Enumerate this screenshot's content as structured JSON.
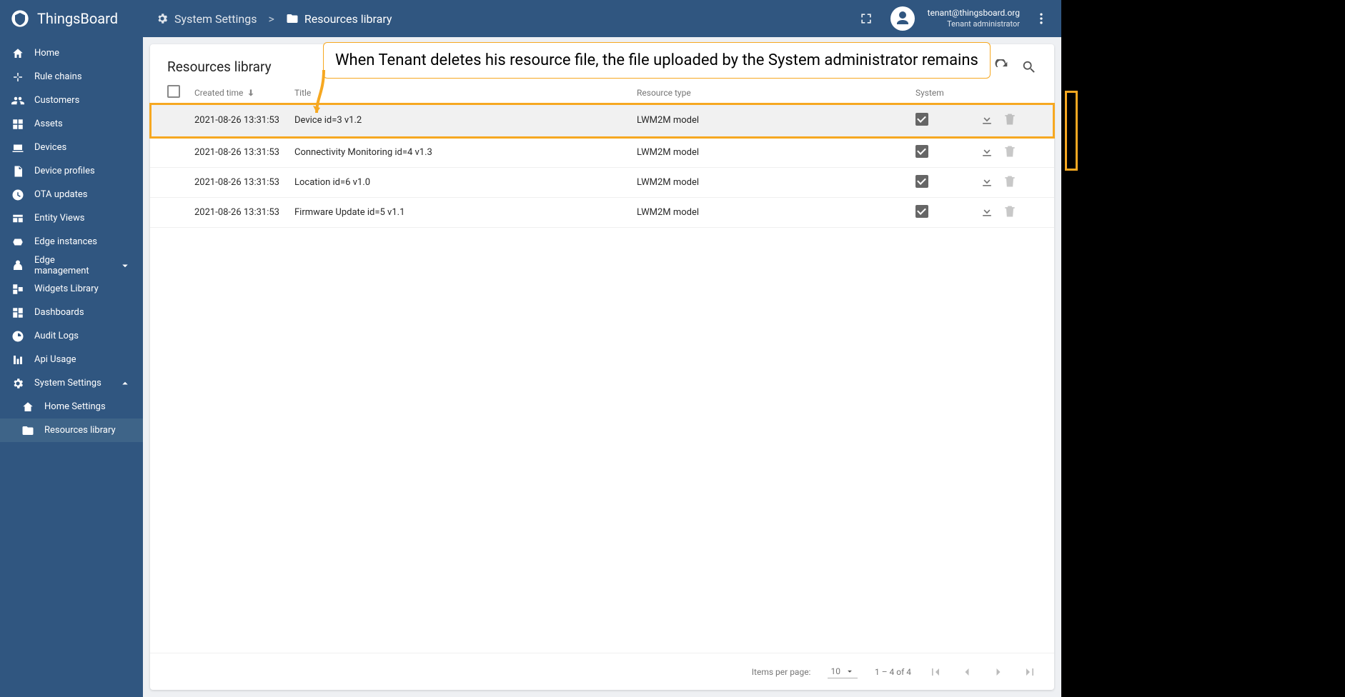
{
  "brand": "ThingsBoard",
  "user": {
    "email": "tenant@thingsboard.org",
    "role": "Tenant administrator"
  },
  "breadcrumb": {
    "parent": "System Settings",
    "current": "Resources library"
  },
  "sidebar": {
    "items": [
      {
        "icon": "home",
        "label": "Home"
      },
      {
        "icon": "rules",
        "label": "Rule chains"
      },
      {
        "icon": "customers",
        "label": "Customers"
      },
      {
        "icon": "assets",
        "label": "Assets"
      },
      {
        "icon": "devices",
        "label": "Devices"
      },
      {
        "icon": "profiles",
        "label": "Device profiles"
      },
      {
        "icon": "ota",
        "label": "OTA updates"
      },
      {
        "icon": "views",
        "label": "Entity Views"
      },
      {
        "icon": "edge",
        "label": "Edge instances"
      },
      {
        "icon": "edgemgmt",
        "label": "Edge management",
        "expand": true
      },
      {
        "icon": "widgets",
        "label": "Widgets Library"
      },
      {
        "icon": "dash",
        "label": "Dashboards"
      },
      {
        "icon": "audit",
        "label": "Audit Logs"
      },
      {
        "icon": "api",
        "label": "Api Usage"
      },
      {
        "icon": "settings",
        "label": "System Settings",
        "expand": true,
        "open": true
      },
      {
        "icon": "homeset",
        "label": "Home Settings",
        "sub": true
      },
      {
        "icon": "folder",
        "label": "Resources library",
        "sub": true,
        "active": true
      }
    ]
  },
  "page": {
    "title": "Resources library",
    "callout": "When Tenant deletes his resource file, the file uploaded by the System administrator remains",
    "columns": {
      "created": "Created time",
      "title": "Title",
      "type": "Resource type",
      "system": "System"
    },
    "rows": [
      {
        "time": "2021-08-26 13:31:53",
        "title": "Device id=3 v1.2",
        "type": "LWM2M model",
        "system": true,
        "highlight": true,
        "canDelete": false
      },
      {
        "time": "2021-08-26 13:31:53",
        "title": "Connectivity Monitoring id=4 v1.3",
        "type": "LWM2M model",
        "system": true,
        "canDelete": false
      },
      {
        "time": "2021-08-26 13:31:53",
        "title": "Location id=6 v1.0",
        "type": "LWM2M model",
        "system": true,
        "canDelete": false
      },
      {
        "time": "2021-08-26 13:31:53",
        "title": "Firmware Update id=5 v1.1",
        "type": "LWM2M model",
        "system": true,
        "canDelete": false
      }
    ],
    "pagination": {
      "label": "Items per page:",
      "size": "10",
      "range": "1 – 4 of 4"
    }
  }
}
